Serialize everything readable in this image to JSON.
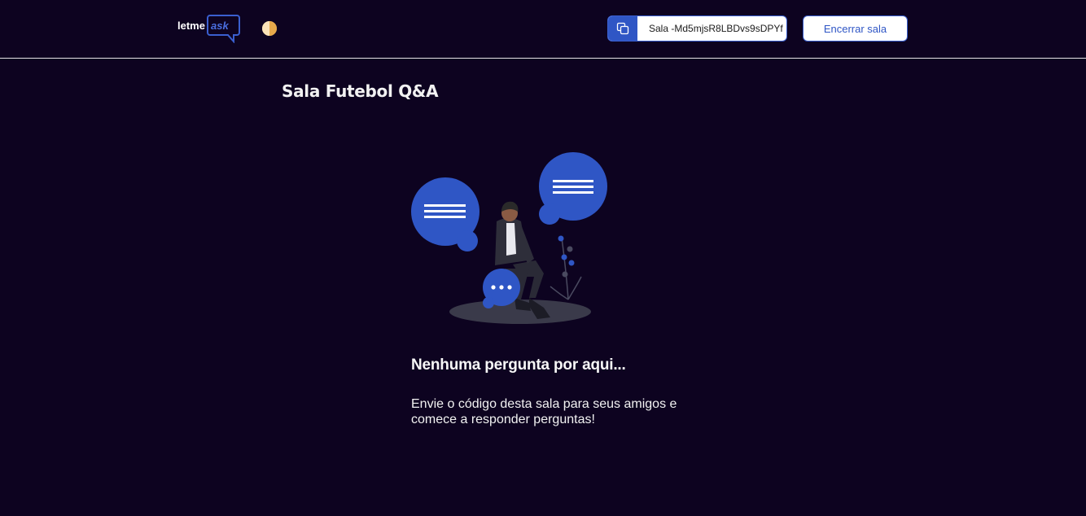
{
  "header": {
    "logo_text_main": "letme",
    "logo_text_accent": "ask",
    "room_code": "Sala -Md5mjsR8LBDvs9sDPYf",
    "close_room_label": "Encerrar sala"
  },
  "main": {
    "room_title": "Sala Futebol Q&A",
    "empty_title": "Nenhuma pergunta por aqui...",
    "empty_description": "Envie o código desta sala para seus amigos e comece a responder perguntas!"
  },
  "icons": {
    "copy": "copy-icon",
    "theme": "theme-toggle-icon"
  },
  "colors": {
    "background": "#0d0320",
    "accent": "#2f56c5",
    "divider": "#e6e6e6"
  }
}
